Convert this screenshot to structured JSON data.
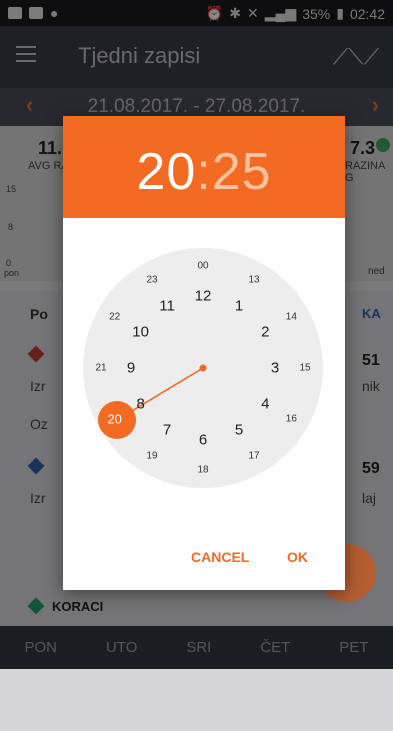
{
  "status": {
    "battery": "35%",
    "clock": "02:42"
  },
  "appbar": {
    "title": "Tjedni zapisi"
  },
  "datebar": {
    "range": "21.08.2017. - 27.08.2017.",
    "prev_icon": "chevron-left-icon",
    "next_icon": "chevron-right-icon"
  },
  "background": {
    "stat_left_value": "11.",
    "stat_left_label": "AVG RA",
    "stat_right_value": "7.3",
    "stat_right_label": "RAZINA G",
    "axis_top": "15",
    "axis_mid": "8",
    "axis_zero": "0",
    "axis_left_day": "pon",
    "axis_right_day": "ned",
    "row_po": "Po",
    "row_ka": "KA",
    "val_51": "51",
    "txt_nik": "nik",
    "txt_izr1": "Izr",
    "txt_oz": "Oz",
    "val_59": "59",
    "txt_laj": "laj",
    "txt_izr2": "Izr",
    "koraci": "KORACI"
  },
  "dialog": {
    "hour": "20",
    "separator": ":",
    "minute": "25",
    "outer_numbers": [
      "12",
      "1",
      "2",
      "3",
      "4",
      "5",
      "6",
      "7",
      "8",
      "9",
      "10",
      "11"
    ],
    "inner_numbers": [
      "00",
      "13",
      "14",
      "15",
      "16",
      "17",
      "18",
      "19",
      "20",
      "21",
      "22",
      "23"
    ],
    "selected": "20",
    "cancel_label": "CANCEL",
    "ok_label": "OK",
    "accent_color": "#f36a22"
  },
  "bottomnav": {
    "items": [
      "PON",
      "UTO",
      "SRI",
      "ČET",
      "PET"
    ]
  }
}
